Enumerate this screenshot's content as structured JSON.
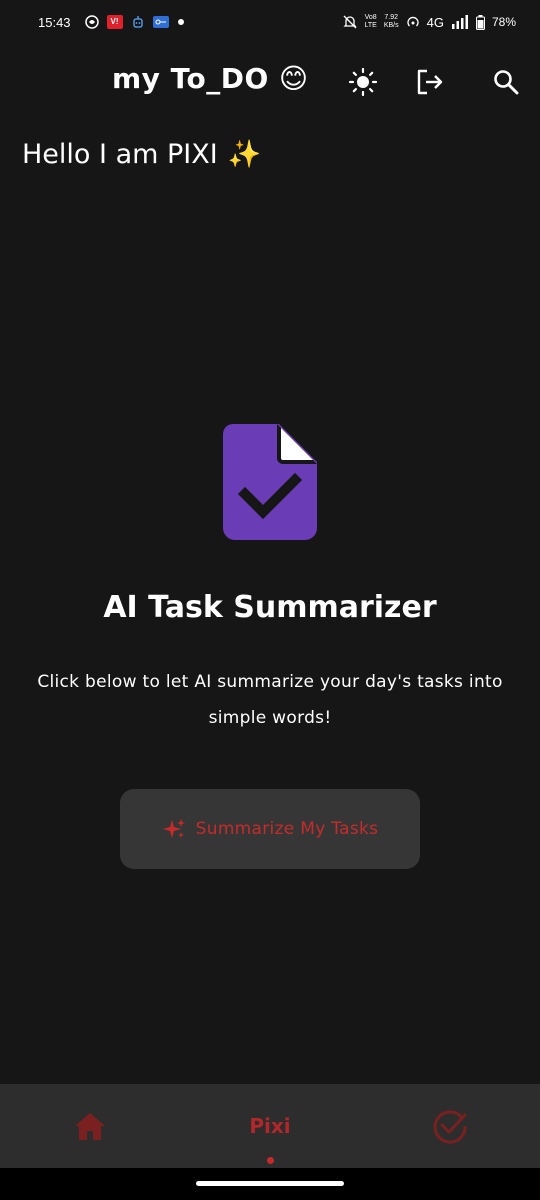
{
  "status_bar": {
    "time": "15:43",
    "network_top": "Vo8",
    "network_bottom": "LTE",
    "speed_top": "7.92",
    "speed_bottom": "KB/s",
    "network_type": "4G",
    "battery": "78%"
  },
  "header": {
    "title": "my To_DO",
    "title_emoji": "😊"
  },
  "greeting": {
    "text": "Hello I am PIXI",
    "emoji": "✨"
  },
  "summarizer": {
    "title": "AI Task Summarizer",
    "description": "Click below to let AI summarize your day's tasks into simple words!",
    "button_label": "Summarize My Tasks"
  },
  "bottom_nav": {
    "active_label": "Pixi"
  },
  "colors": {
    "background": "#161616",
    "accent_red": "#c62b2b",
    "icon_purple": "#6a3cb5",
    "button_bg": "#363636",
    "nav_bg": "#2d2d2d"
  }
}
